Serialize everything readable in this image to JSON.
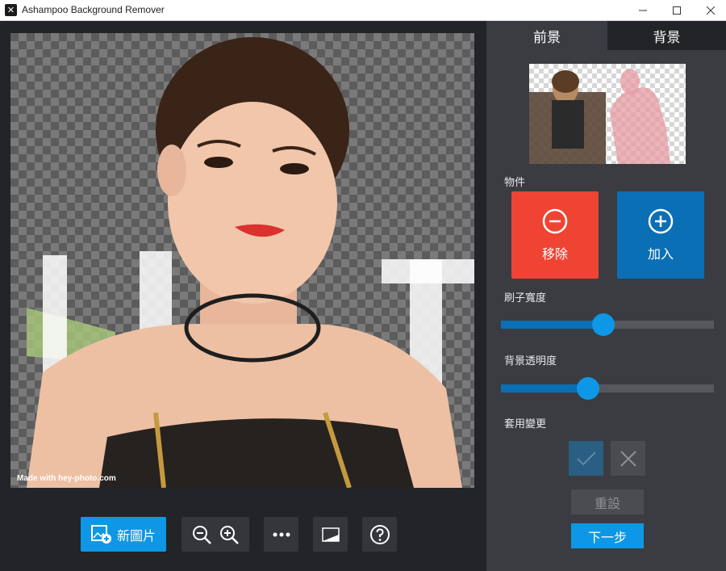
{
  "window": {
    "title": "Ashampoo Background Remover"
  },
  "canvas": {
    "watermark": "Made with hey-photo.com"
  },
  "toolbar": {
    "new_image_label": "新圖片"
  },
  "panel": {
    "tabs": [
      {
        "label": "前景"
      },
      {
        "label": "背景"
      }
    ],
    "object_label": "物件",
    "remove_label": "移除",
    "add_label": "加入",
    "brush_width_label": "刷子寬度",
    "brush_width_value": 0.48,
    "bg_opacity_label": "背景透明度",
    "bg_opacity_value": 0.41,
    "apply_changes_label": "套用變更",
    "reset_label": "重設",
    "next_label": "下一步"
  },
  "colors": {
    "accent": "#0e97e6",
    "remove": "#ef4433",
    "add": "#0b6fb5"
  },
  "icons": [
    "app-icon",
    "minimize-icon",
    "maximize-icon",
    "close-icon",
    "new-image-icon",
    "zoom-out-icon",
    "zoom-in-icon",
    "more-icon",
    "compare-icon",
    "help-icon",
    "minus-circle-icon",
    "plus-circle-icon",
    "check-icon",
    "x-icon"
  ]
}
